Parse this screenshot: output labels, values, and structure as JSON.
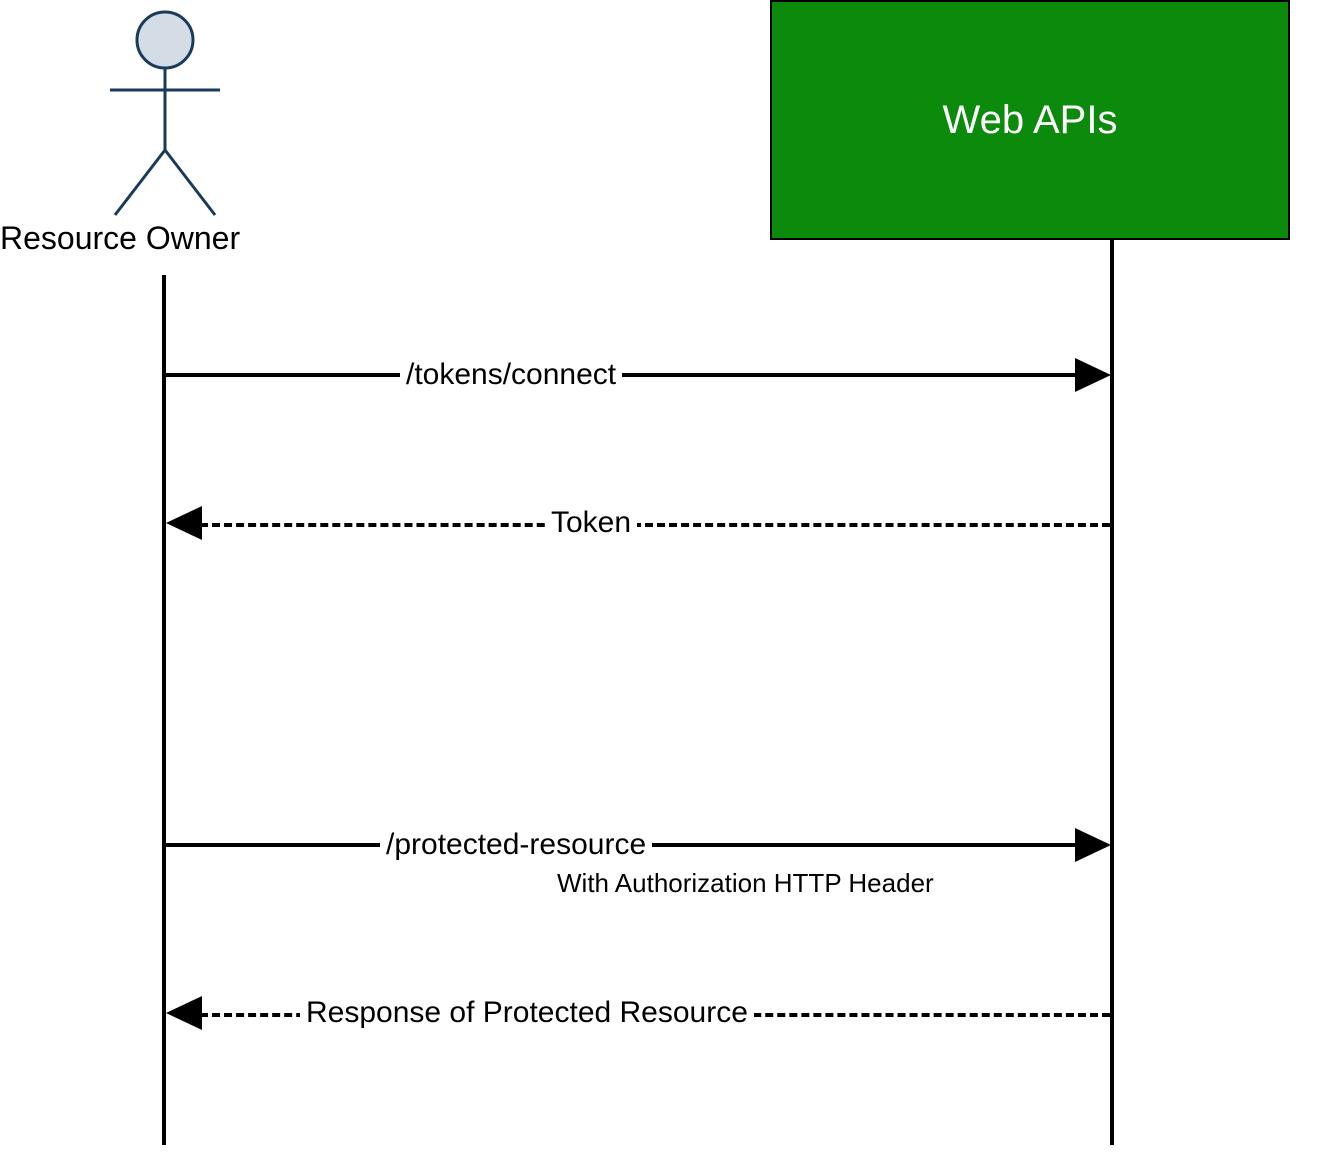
{
  "actors": {
    "resource_owner": {
      "label": "Resource Owner"
    },
    "web_apis": {
      "label": "Web APIs"
    }
  },
  "messages": {
    "m1": {
      "label": "/tokens/connect"
    },
    "m2": {
      "label": "Token"
    },
    "m3": {
      "label": "/protected-resource",
      "sublabel": "With Authorization HTTP Header"
    },
    "m4": {
      "label": "Response of Protected Resource"
    }
  },
  "colors": {
    "webapi_bg": "#0b8a0b",
    "actor_stroke": "#1a3a5c",
    "actor_fill": "#d4dde6"
  }
}
